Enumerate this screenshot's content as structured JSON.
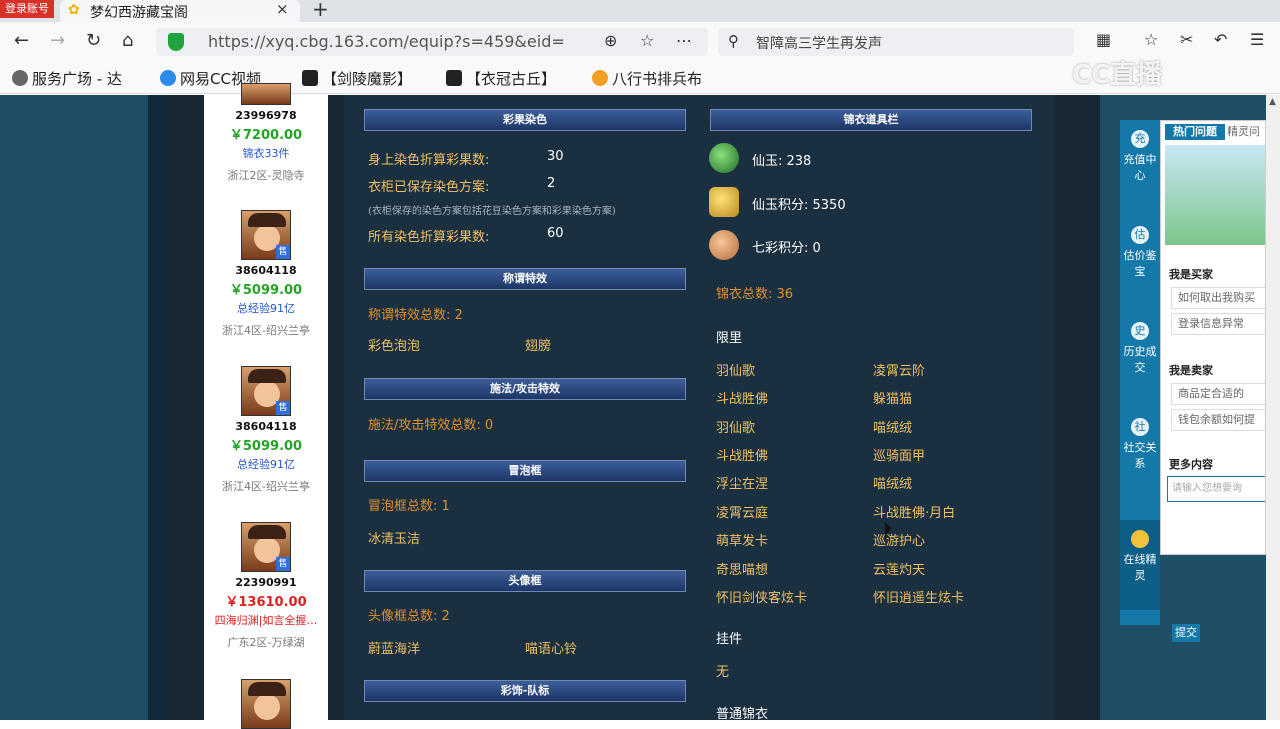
{
  "browser": {
    "login_badge": "登录账号",
    "tab_title": "梦幻西游藏宝阁",
    "tab_close": "×",
    "new_tab": "+",
    "url": "https://xyq.cbg.163.com/equip?s=459&eid=",
    "search_text": "智障高三学生再发声",
    "bookmarks": [
      "服务广场 - 达",
      "网易CC视频",
      "【剑陵魔影】",
      "【衣冠古丘】",
      "八行书排兵布"
    ],
    "watermark": "CC直播"
  },
  "listing": [
    {
      "eid": "23996978",
      "price": "￥7200.00",
      "sub": "锦衣33件",
      "server": "浙江2区-灵隐寺",
      "price_color": "green"
    },
    {
      "eid": "38604118",
      "price": "￥5099.00",
      "sub": "总经验91亿",
      "server": "浙江4区-绍兴兰亭",
      "price_color": "green"
    },
    {
      "eid": "38604118",
      "price": "￥5099.00",
      "sub": "总经验91亿",
      "server": "浙江4区-绍兴兰亭",
      "price_color": "green"
    },
    {
      "eid": "22390991",
      "price": "￥13610.00",
      "sub": "四海归渊|如言全握…",
      "server": "广东2区-万绿湖",
      "price_color": "red"
    }
  ],
  "sell_tag": "售",
  "left": {
    "caiguo_header": "彩果染色",
    "body_dye_label": "身上染色折算彩果数:",
    "body_dye_value": "30",
    "wardrobe_label": "衣柜已保存染色方案:",
    "wardrobe_value": "2",
    "wardrobe_note": "(衣柜保存的染色方案包括花豆染色方案和彩果染色方案)",
    "all_dye_label": "所有染色折算彩果数:",
    "all_dye_value": "60",
    "title_effect_header": "称谓特效",
    "title_effect_total": "称谓特效总数: 2",
    "title_effects": [
      "彩色泡泡",
      "翅膀"
    ],
    "cast_header": "施法/攻击特效",
    "cast_total": "施法/攻击特效总数: 0",
    "bubble_header": "冒泡框",
    "bubble_total": "冒泡框总数: 1",
    "bubbles": [
      "冰清玉洁"
    ],
    "avatar_frame_header": "头像框",
    "avatar_frame_total": "头像框总数: 2",
    "avatar_frames": [
      "蔚蓝海洋",
      "喵语心铃"
    ],
    "team_header": "彩饰-队标"
  },
  "right": {
    "header": "锦衣道具栏",
    "xianyu": "仙玉: 238",
    "xianyu_points": "仙玉积分: 5350",
    "qicai_points": "七彩积分: 0",
    "jinyi_total": "锦衣总数: 36",
    "limited_label": "限里",
    "limited_items": [
      "羽仙歌",
      "凌霄云阶",
      "斗战胜佛",
      "躲猫猫",
      "羽仙歌",
      "喵绒绒",
      "斗战胜佛",
      "巡骑面甲",
      "浮尘在涅",
      "喵绒绒",
      "凌霄云庭",
      "斗战胜佛·月白",
      "萌草发卡",
      "巡游护心",
      "奇思喵想",
      "云莲灼天",
      "怀旧剑侠客炫卡",
      "怀旧逍遥生炫卡"
    ],
    "pendant_label": "挂件",
    "pendant_value": "无",
    "normal_label": "普通锦衣"
  },
  "sidebar": [
    {
      "icon": "充",
      "label": "充值中心"
    },
    {
      "icon": "估",
      "label": "估价鉴宝"
    },
    {
      "icon": "史",
      "label": "历史成交"
    },
    {
      "icon": "社",
      "label": "社交关系"
    }
  ],
  "sprite": {
    "label": "在线精灵"
  },
  "help": {
    "tab1": "热门问题",
    "tab2": "精灵问",
    "buyer_head": "我是买家",
    "buyer_q1": "如何取出我购买",
    "buyer_q2": "登录信息异常",
    "seller_head": "我是卖家",
    "seller_q1": "商品定合适的",
    "seller_q2": "钱包余额如何提",
    "more_head": "更多内容",
    "input_placeholder": "请输入您想要询",
    "submit": "提交"
  }
}
